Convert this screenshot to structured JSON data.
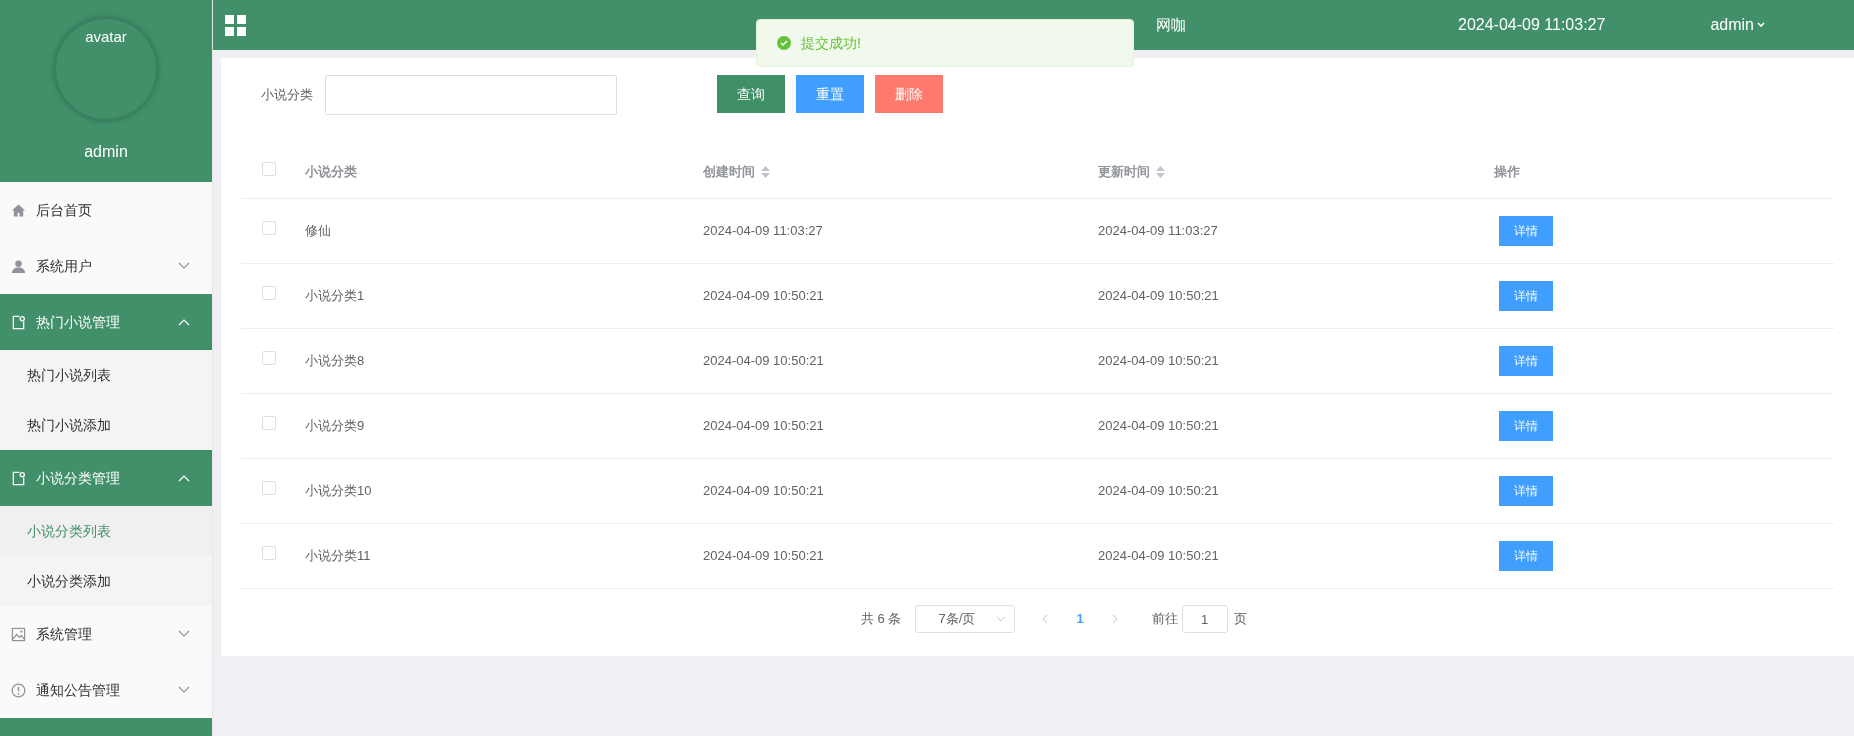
{
  "sidebar": {
    "avatar_label": "avatar",
    "username": "admin",
    "menu": [
      {
        "label": "后台首页",
        "kind": "home",
        "expandable": false,
        "expanded": false
      },
      {
        "label": "系统用户",
        "kind": "user",
        "expandable": true,
        "expanded": false
      },
      {
        "label": "热门小说管理",
        "kind": "doc",
        "expandable": true,
        "expanded": true,
        "children": [
          {
            "label": "热门小说列表",
            "selected": false
          },
          {
            "label": "热门小说添加",
            "selected": false
          }
        ]
      },
      {
        "label": "小说分类管理",
        "kind": "doc",
        "expandable": true,
        "expanded": true,
        "children": [
          {
            "label": "小说分类列表",
            "selected": true
          },
          {
            "label": "小说分类添加",
            "selected": false
          }
        ]
      },
      {
        "label": "系统管理",
        "kind": "image",
        "expandable": true,
        "expanded": false
      },
      {
        "label": "通知公告管理",
        "kind": "alert",
        "expandable": true,
        "expanded": false
      }
    ]
  },
  "topbar": {
    "title": "网咖",
    "datetime": "2024-04-09 11:03:27",
    "user": "admin"
  },
  "toast": {
    "message": "提交成功!"
  },
  "search": {
    "label": "小说分类"
  },
  "buttons": [
    {
      "label": "查询",
      "kind": "primary"
    },
    {
      "label": "重置",
      "kind": "info"
    },
    {
      "label": "删除",
      "kind": "danger"
    }
  ],
  "table": {
    "columns": [
      {
        "label": "小说分类",
        "sortable": false
      },
      {
        "label": "创建时间",
        "sortable": true
      },
      {
        "label": "更新时间",
        "sortable": true
      },
      {
        "label": "操作",
        "sortable": false
      }
    ],
    "all_checked": false,
    "rows": [
      {
        "checked": false,
        "name": "修仙",
        "created": "2024-04-09 11:03:27",
        "updated": "2024-04-09 11:03:27",
        "action": "详情"
      },
      {
        "checked": false,
        "name": "小说分类1",
        "created": "2024-04-09 10:50:21",
        "updated": "2024-04-09 10:50:21",
        "action": "详情"
      },
      {
        "checked": false,
        "name": "小说分类8",
        "created": "2024-04-09 10:50:21",
        "updated": "2024-04-09 10:50:21",
        "action": "详情"
      },
      {
        "checked": false,
        "name": "小说分类9",
        "created": "2024-04-09 10:50:21",
        "updated": "2024-04-09 10:50:21",
        "action": "详情"
      },
      {
        "checked": false,
        "name": "小说分类10",
        "created": "2024-04-09 10:50:21",
        "updated": "2024-04-09 10:50:21",
        "action": "详情"
      },
      {
        "checked": false,
        "name": "小说分类11",
        "created": "2024-04-09 10:50:21",
        "updated": "2024-04-09 10:50:21",
        "action": "详情"
      }
    ]
  },
  "pagination": {
    "total": "共 6 条",
    "page_size": "7条/页",
    "pages": [
      {
        "label": "1",
        "selected": true
      }
    ],
    "goto_label": "前往",
    "goto_value": "1",
    "goto_suffix": "页"
  }
}
